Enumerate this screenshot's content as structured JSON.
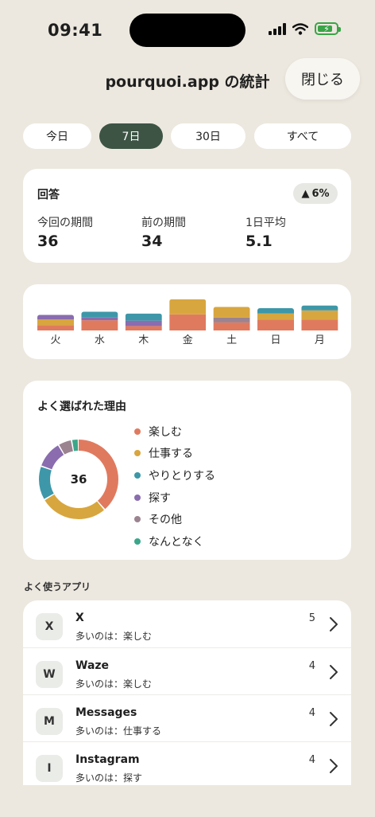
{
  "status": {
    "time": "09:41"
  },
  "header": {
    "title": "pourquoi.app の統計",
    "close_label": "閉じる"
  },
  "ranges": [
    {
      "label": "今日",
      "active": false
    },
    {
      "label": "7日",
      "active": true
    },
    {
      "label": "30日",
      "active": false
    },
    {
      "label": "すべて",
      "active": false
    }
  ],
  "answers": {
    "title": "回答",
    "change": "6%",
    "stats": [
      {
        "label": "今回の期間",
        "value": "36"
      },
      {
        "label": "前の期間",
        "value": "34"
      },
      {
        "label": "1日平均",
        "value": "5.1"
      }
    ]
  },
  "colors": {
    "enjoy": "#E07A5F",
    "work": "#D8A63E",
    "chat": "#3D97A8",
    "search": "#8A6CAF",
    "other": "#9B8390",
    "idle": "#3AA68A"
  },
  "weekly": {
    "days": [
      {
        "label": "火",
        "segments": {
          "enjoy": 1.2,
          "work": 1.3,
          "chat": 0,
          "search": 1.0,
          "other": 0,
          "idle": 0
        }
      },
      {
        "label": "水",
        "segments": {
          "enjoy": 2.3,
          "work": 0,
          "chat": 1.3,
          "search": 0.6,
          "other": 0,
          "idle": 0
        }
      },
      {
        "label": "木",
        "segments": {
          "enjoy": 1.0,
          "work": 0,
          "chat": 1.6,
          "search": 1.2,
          "other": 0,
          "idle": 0
        }
      },
      {
        "label": "金",
        "segments": {
          "enjoy": 3.6,
          "work": 3.4,
          "chat": 0,
          "search": 0,
          "other": 0,
          "idle": 0
        }
      },
      {
        "label": "土",
        "segments": {
          "enjoy": 1.8,
          "work": 2.4,
          "chat": 0,
          "search": 0,
          "other": 1.1,
          "idle": 0
        }
      },
      {
        "label": "日",
        "segments": {
          "enjoy": 2.4,
          "work": 1.4,
          "chat": 1.2,
          "search": 0,
          "other": 0,
          "idle": 0
        }
      },
      {
        "label": "月",
        "segments": {
          "enjoy": 2.4,
          "work": 2.1,
          "chat": 1.1,
          "search": 0,
          "other": 0,
          "idle": 0
        }
      }
    ]
  },
  "reasons": {
    "title": "よく選ばれた理由",
    "total": "36",
    "items": [
      {
        "key": "enjoy",
        "label": "楽しむ",
        "count": 14
      },
      {
        "key": "work",
        "label": "仕事する",
        "count": 10
      },
      {
        "key": "chat",
        "label": "やりとりする",
        "count": 5
      },
      {
        "key": "search",
        "label": "探す",
        "count": 4
      },
      {
        "key": "other",
        "label": "その他",
        "count": 2
      },
      {
        "key": "idle",
        "label": "なんとなく",
        "count": 1
      }
    ]
  },
  "apps": {
    "title": "よく使うアプリ",
    "items": [
      {
        "initial": "X",
        "name": "X",
        "sub": "多いのは：楽しむ",
        "count": "5"
      },
      {
        "initial": "W",
        "name": "Waze",
        "sub": "多いのは：楽しむ",
        "count": "4"
      },
      {
        "initial": "M",
        "name": "Messages",
        "sub": "多いのは：仕事する",
        "count": "4"
      },
      {
        "initial": "I",
        "name": "Instagram",
        "sub": "多いのは：探す",
        "count": "4"
      }
    ]
  }
}
